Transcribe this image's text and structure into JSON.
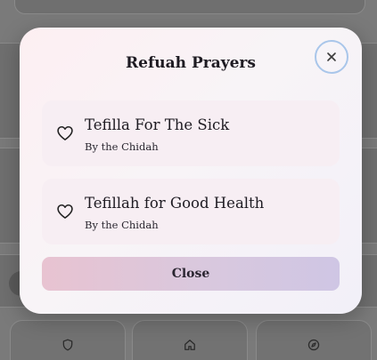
{
  "modal": {
    "title": "Refuah Prayers",
    "close_button_label": "Close",
    "prayers": [
      {
        "title": "Tefilla For The Sick",
        "author": "By the Chidah",
        "icon": "heart-outline-icon"
      },
      {
        "title": "Tefillah for Good Health",
        "author": "By the Chidah",
        "icon": "heart-outline-icon"
      }
    ]
  },
  "nav": {
    "items": [
      {
        "icon": "shield-icon"
      },
      {
        "icon": "home-icon"
      },
      {
        "icon": "compass-icon"
      }
    ]
  },
  "colors": {
    "accent_gradient_start": "#e8c3d1",
    "accent_gradient_end": "#cfc6e4",
    "close_ring": "#a9c6ea"
  }
}
